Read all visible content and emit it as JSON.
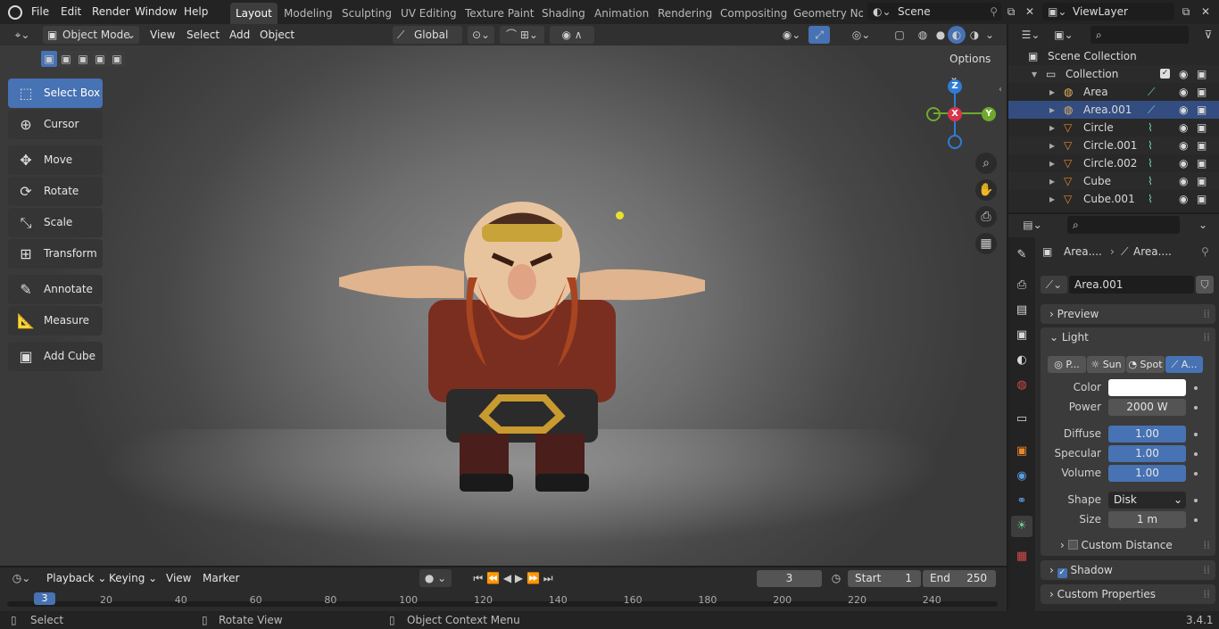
{
  "topbar": {
    "menus": [
      "File",
      "Edit",
      "Render",
      "Window",
      "Help"
    ],
    "workspaces": [
      "Layout",
      "Modeling",
      "Sculpting",
      "UV Editing",
      "Texture Paint",
      "Shading",
      "Animation",
      "Rendering",
      "Compositing",
      "Geometry Noc"
    ],
    "active_workspace": "Layout",
    "scene": "Scene",
    "view_layer": "ViewLayer"
  },
  "viewport_header": {
    "mode": "Object Mode",
    "menus": [
      "View",
      "Select",
      "Add",
      "Object"
    ],
    "orientation": "Global",
    "options": "Options"
  },
  "toolbar": {
    "tools": [
      {
        "label": "Select Box",
        "icon": "select-box-icon",
        "active": true
      },
      {
        "label": "Cursor",
        "icon": "cursor-icon",
        "active": false
      },
      {
        "label": "Move",
        "icon": "move-icon",
        "active": false
      },
      {
        "label": "Rotate",
        "icon": "rotate-icon",
        "active": false
      },
      {
        "label": "Scale",
        "icon": "scale-icon",
        "active": false
      },
      {
        "label": "Transform",
        "icon": "transform-icon",
        "active": false
      },
      {
        "label": "Annotate",
        "icon": "annotate-icon",
        "active": false
      },
      {
        "label": "Measure",
        "icon": "measure-icon",
        "active": false
      },
      {
        "label": "Add Cube",
        "icon": "add-cube-icon",
        "active": false
      }
    ]
  },
  "gizmo": {
    "x": "X",
    "y": "Y",
    "z": "Z"
  },
  "outliner": {
    "root": "Scene Collection",
    "collection": "Collection",
    "items": [
      {
        "name": "Area",
        "type": "light"
      },
      {
        "name": "Area.001",
        "type": "light",
        "selected": true
      },
      {
        "name": "Circle",
        "type": "mesh"
      },
      {
        "name": "Circle.001",
        "type": "mesh"
      },
      {
        "name": "Circle.002",
        "type": "mesh"
      },
      {
        "name": "Cube",
        "type": "mesh"
      },
      {
        "name": "Cube.001",
        "type": "mesh"
      }
    ]
  },
  "properties": {
    "breadcrumb": [
      "Area....",
      "Area...."
    ],
    "datablock": "Area.001",
    "preview_label": "Preview",
    "light_label": "Light",
    "light_types": [
      "P...",
      "Sun",
      "Spot",
      "A..."
    ],
    "active_light_type": "A...",
    "color_label": "Color",
    "color_value": "#ffffff",
    "power_label": "Power",
    "power_value": "2000 W",
    "diffuse_label": "Diffuse",
    "diffuse_value": "1.00",
    "specular_label": "Specular",
    "specular_value": "1.00",
    "volume_label": "Volume",
    "volume_value": "1.00",
    "shape_label": "Shape",
    "shape_value": "Disk",
    "size_label": "Size",
    "size_value": "1 m",
    "custom_distance_label": "Custom Distance",
    "shadow_label": "Shadow",
    "custom_props_label": "Custom Properties"
  },
  "timeline": {
    "menus": [
      "Playback",
      "Keying",
      "View",
      "Marker"
    ],
    "current_frame": "3",
    "start_label": "Start",
    "start_value": "1",
    "end_label": "End",
    "end_value": "250",
    "ticks": [
      "20",
      "40",
      "60",
      "80",
      "100",
      "120",
      "140",
      "160",
      "180",
      "200",
      "220",
      "240"
    ],
    "playhead": "3"
  },
  "statusbar": {
    "select": "Select",
    "rotate": "Rotate View",
    "context": "Object Context Menu",
    "version": "3.4.1"
  },
  "colors": {
    "accent": "#4772b3",
    "selection": "#334d80",
    "background": "#303030"
  }
}
